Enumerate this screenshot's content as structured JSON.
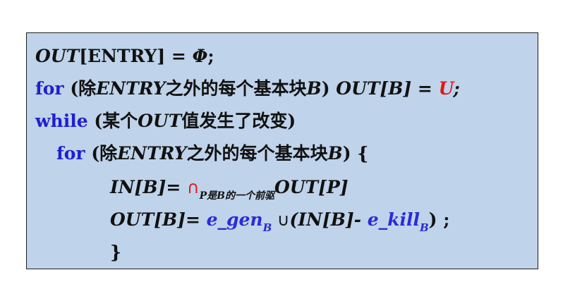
{
  "lines": {
    "line1": {
      "out": "OUT",
      "bracket": "[ENTRY] = ",
      "phi": "Φ",
      "semi": ";"
    },
    "line2": {
      "kw": "for",
      "paren": " (除",
      "entry": "ENTRY",
      "zh": "之外的每个基本块",
      "b": "B",
      "close": ") ",
      "outb": "OUT[B] = ",
      "u": "U",
      "semi": ";"
    },
    "line3": {
      "kw": "while",
      "text": " (某个",
      "out": "OUT",
      "text2": "值发生了改变)"
    },
    "line4": {
      "kw": "for",
      "paren": " (除",
      "entry": "ENTRY",
      "zh": "之外的每个基本块",
      "b": "B",
      "close": ") {"
    },
    "line5": {
      "inb": "IN[B]",
      "eq": "= ",
      "cap": "∩",
      "subscript": "P是B的一个前驱",
      "outp": "OUT[P]"
    },
    "line6": {
      "outb": "OUT[B]",
      "eq": "= ",
      "egen": "e_gen",
      "egen_sub": "B",
      "cup": " ∪",
      "mid": "(IN[B]- ",
      "ekill": "e_kill",
      "ekill_sub": "B",
      "end": ") ;"
    },
    "line7": {
      "brace": "}"
    }
  },
  "colors": {
    "background": "#bfd3ea",
    "keyword": "#1f1fd1",
    "highlight_red": "#e01818",
    "variable_blue": "#2b2bd8"
  }
}
